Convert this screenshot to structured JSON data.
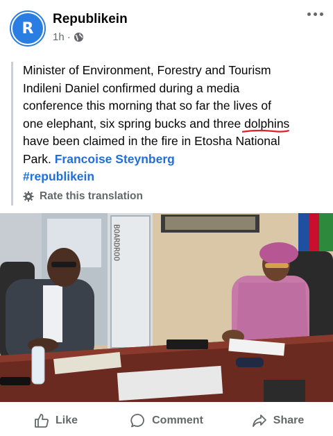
{
  "post": {
    "page_name": "Republikein",
    "avatar_letter": "R",
    "time": "1h",
    "audience_icon": "globe-icon",
    "more_icon": "more-dots-icon"
  },
  "translation": {
    "text_lines": [
      "Minister of Environment, Forestry and Tourism",
      "Indileni Daniel confirmed during a media",
      "conference this morning that so far the lives of",
      "one elephant, six spring bucks and three"
    ],
    "underlined_word": "dolphins",
    "text_continued_1": "have been claimed in the fire in Etosha National",
    "text_continued_2": "Park.",
    "author_link": "Francoise Steynberg",
    "hashtag": "#republikein",
    "rate_label": "Rate this translation"
  },
  "photo": {
    "sign_text": "BOARDROO",
    "description_icon": "press-photo"
  },
  "actions": {
    "like": "Like",
    "comment": "Comment",
    "share": "Share"
  },
  "colors": {
    "link": "#216fdb",
    "muted": "#65676b",
    "avatar": "#2a7de1",
    "underline": "#e01e2a"
  }
}
